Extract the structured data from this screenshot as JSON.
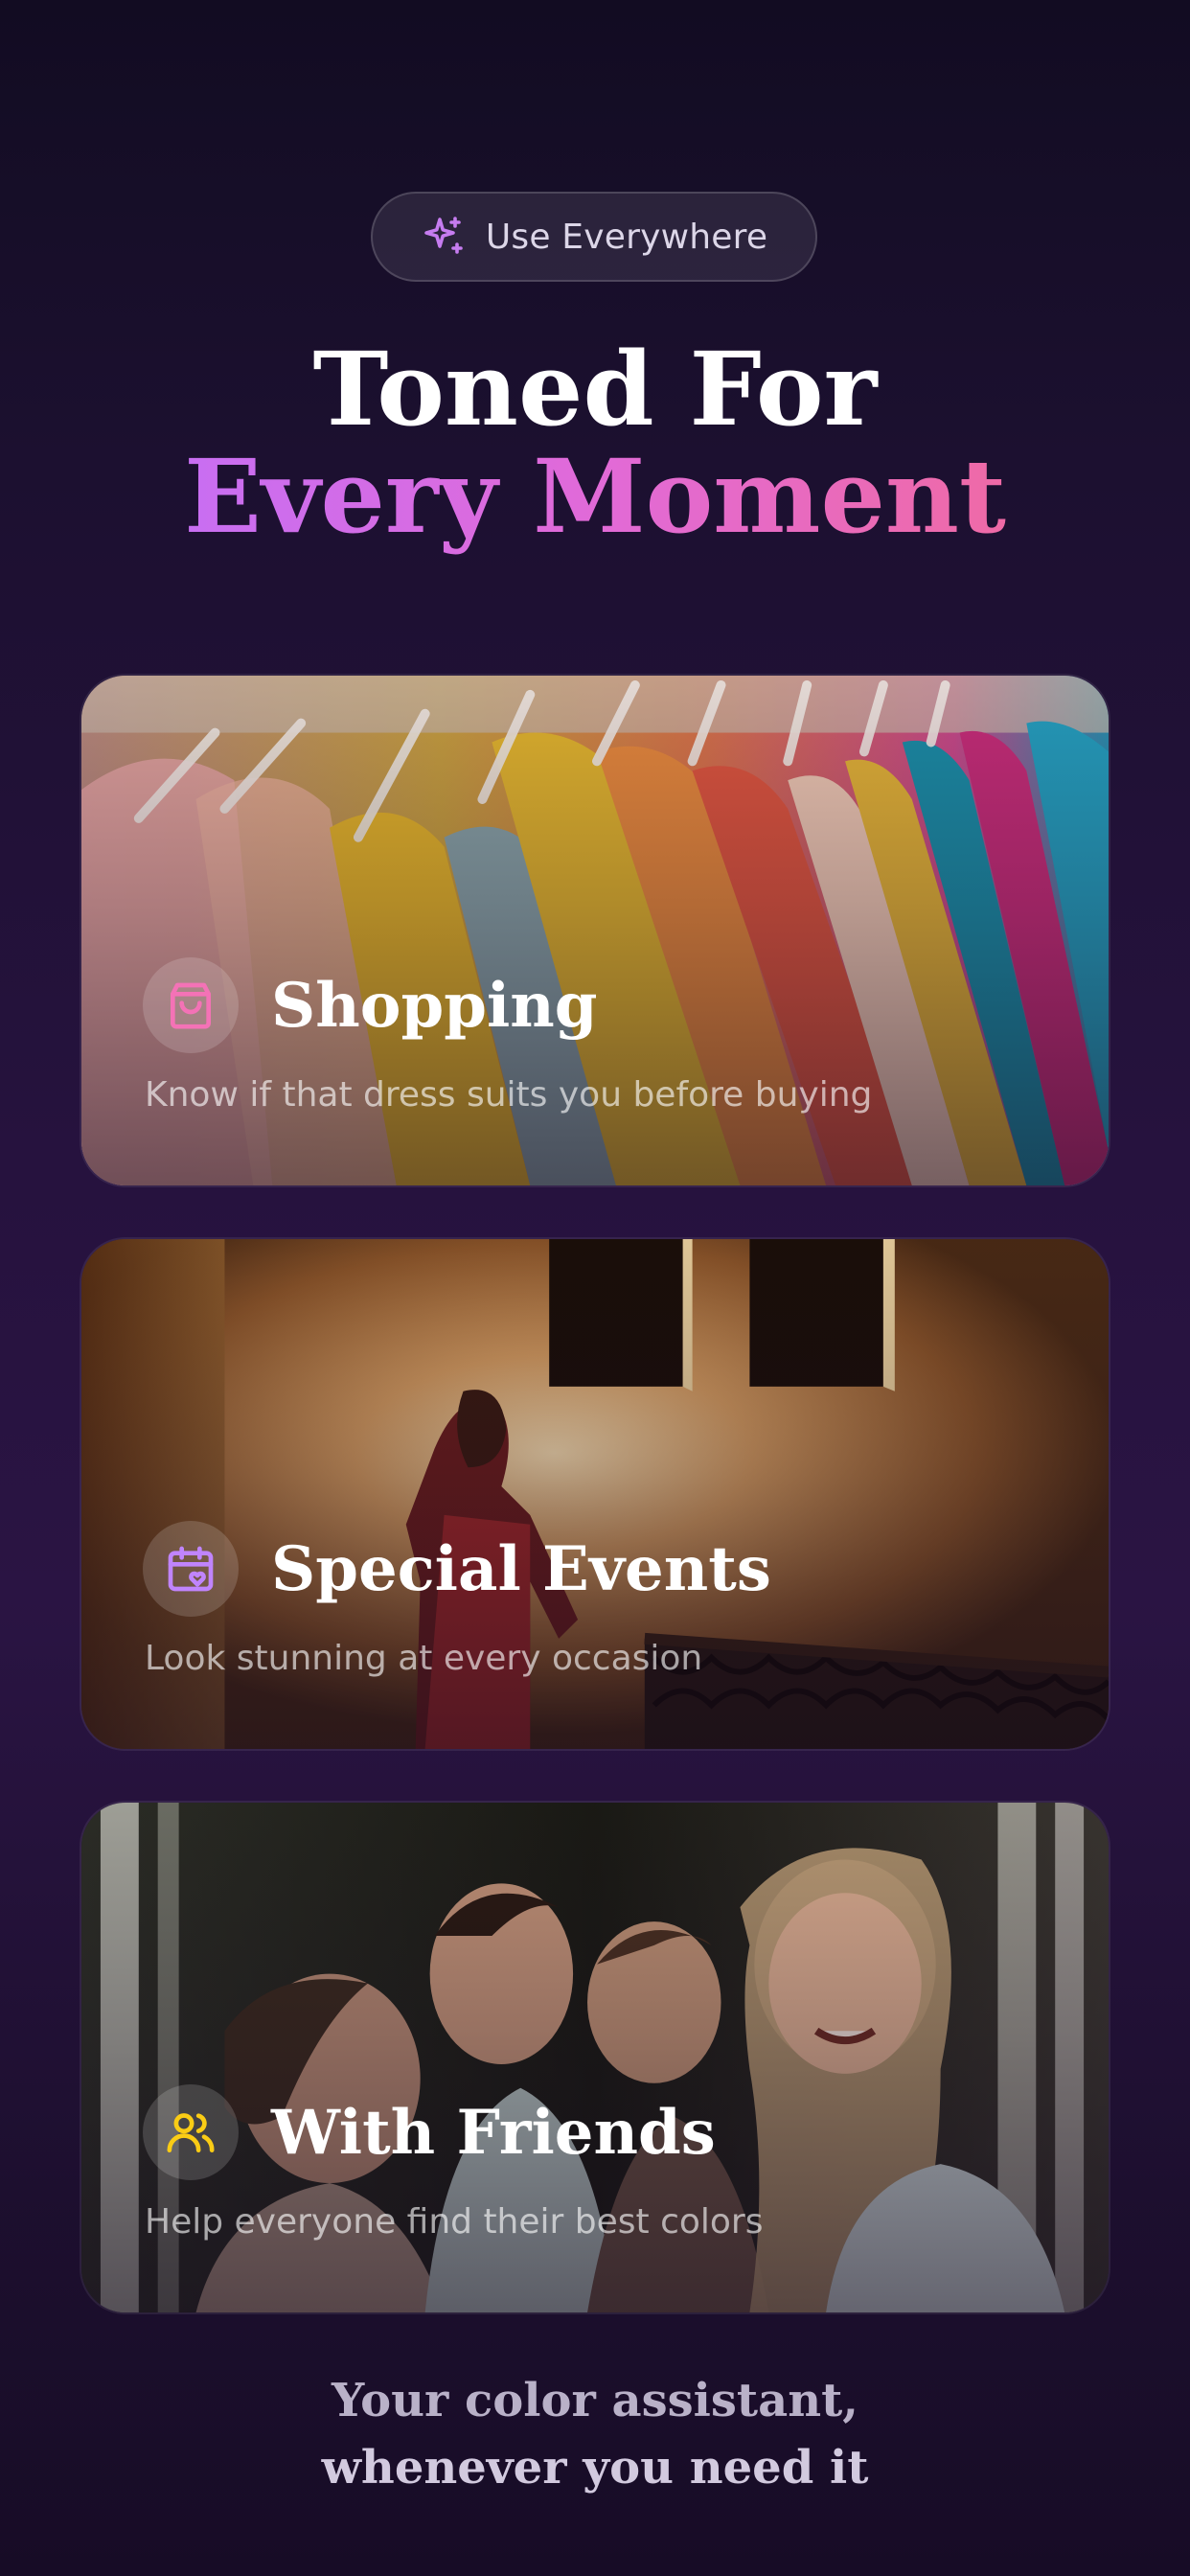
{
  "badge": {
    "icon": "sparkle-icon",
    "label": "Use Everywhere"
  },
  "heading": {
    "line1": "Toned For",
    "line2": "Every Moment"
  },
  "cards": [
    {
      "icon": "shopping-bag-icon",
      "icon_color": "#f472b6",
      "title": "Shopping",
      "subtitle": "Know if that dress suits you before buying"
    },
    {
      "icon": "calendar-heart-icon",
      "icon_color": "#c084fc",
      "title": "Special Events",
      "subtitle": "Look stunning at every occasion"
    },
    {
      "icon": "users-icon",
      "icon_color": "#facc15",
      "title": "With Friends",
      "subtitle": "Help everyone find their best colors"
    }
  ],
  "tagline": {
    "line1": "Your color assistant,",
    "line2": "whenever you need it"
  },
  "colors": {
    "accent_purple": "#c86ef2",
    "accent_pink": "#ef6aa6",
    "background": "#26123e"
  }
}
